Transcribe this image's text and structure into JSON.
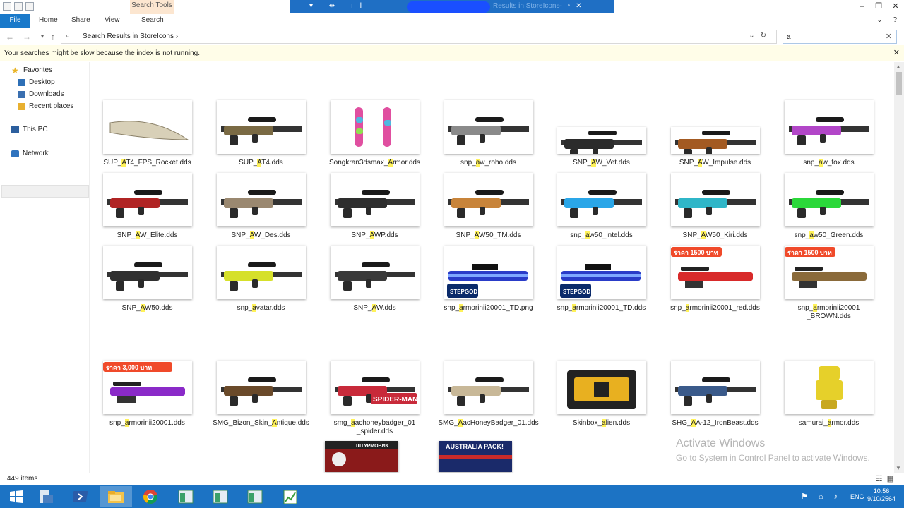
{
  "window": {
    "qat_icons": [
      "folder-icon",
      "properties-icon",
      "new-folder-icon"
    ],
    "contextual_tab": "Search Tools",
    "title_text": "Results in StoreIcons",
    "controls": [
      "minimize",
      "maximize",
      "close"
    ]
  },
  "ribbon": {
    "tabs": [
      "File",
      "Home",
      "Share",
      "View",
      "Search"
    ]
  },
  "address": {
    "path": "Search Results in StoreIcons",
    "search_value": "a"
  },
  "infobar": {
    "message": "Your searches might be slow because the index is not running."
  },
  "nav": {
    "favorites": "Favorites",
    "desktop": "Desktop",
    "downloads": "Downloads",
    "recent": "Recent places",
    "this_pc": "This PC",
    "network": "Network"
  },
  "items": [
    {
      "pre": "SUP_",
      "hl": "A",
      "post": "T4_FPS_Rocket.dds",
      "color": "#d8d0b8"
    },
    {
      "pre": "SUP_",
      "hl": "A",
      "post": "T4.dds",
      "color": "#7a6a44"
    },
    {
      "pre": "Songkran3dsmax_",
      "hl": "A",
      "post": "rmor.dds",
      "color": "#d34f9a"
    },
    {
      "pre": "snp_",
      "hl": "a",
      "post": "w_robo.dds",
      "color": "#8a8a8a"
    },
    {
      "pre": "SNP_",
      "hl": "A",
      "post": "W_Vet.dds",
      "color": "#2b2b2b"
    },
    {
      "pre": "SNP_",
      "hl": "A",
      "post": "W_Impulse.dds",
      "color": "#a35a22"
    },
    {
      "pre": "snp_",
      "hl": "a",
      "post": "w_fox.dds",
      "color": "#b246c8"
    },
    {
      "pre": "SNP_",
      "hl": "A",
      "post": "W_Elite.dds",
      "color": "#b02424"
    },
    {
      "pre": "SNP_",
      "hl": "A",
      "post": "W_Des.dds",
      "color": "#9a8870"
    },
    {
      "pre": "SNP_",
      "hl": "A",
      "post": "WP.dds",
      "color": "#2e2e2e"
    },
    {
      "pre": "SNP_",
      "hl": "A",
      "post": "W50_TM.dds",
      "color": "#c8843a"
    },
    {
      "pre": "snp_",
      "hl": "a",
      "post": "w50_intel.dds",
      "color": "#2aa6e8"
    },
    {
      "pre": "SNP_",
      "hl": "A",
      "post": "W50_Kiri.dds",
      "color": "#2fb6c8"
    },
    {
      "pre": "snp_",
      "hl": "a",
      "post": "w50_Green.dds",
      "color": "#2bd83a"
    },
    {
      "pre": "SNP_",
      "hl": "A",
      "post": "W50.dds",
      "color": "#303030"
    },
    {
      "pre": "snp_",
      "hl": "a",
      "post": "vatar.dds",
      "color": "#d6e02a"
    },
    {
      "pre": "SNP_",
      "hl": "A",
      "post": "W.dds",
      "color": "#3a3a3a"
    },
    {
      "pre": "snp_",
      "hl": "a",
      "post": "rmorinii20001_TD.png",
      "color": "#2a3cc8"
    },
    {
      "pre": "snp_",
      "hl": "a",
      "post": "rmorinii20001_TD.dds",
      "color": "#2a3cc8"
    },
    {
      "pre": "snp_",
      "hl": "a",
      "post": "rmorinii20001_red.dds",
      "color": "#d82a2a"
    },
    {
      "pre": "snp_",
      "hl": "a",
      "post": "rmorinii20001",
      "line2": "_BROWN.dds",
      "color": "#8a6a3a"
    },
    {
      "pre": "snp_",
      "hl": "a",
      "post": "rmorinii20001.dds",
      "color": "#8a2ac8"
    },
    {
      "pre": "SMG_Bizon_Skin_",
      "hl": "A",
      "post": "ntique.dds",
      "color": "#6a4a2a"
    },
    {
      "pre": "smg_",
      "hl": "a",
      "post": "achoneybadger_01",
      "line2": "_spider.dds",
      "color": "#c82a3a"
    },
    {
      "pre": "SMG_",
      "hl": "A",
      "post": "acHoneyBadger_01.dds",
      "color": "#c8b898"
    },
    {
      "pre": "Skinbox_",
      "hl": "a",
      "post": "lien.dds",
      "color": "#e8b020"
    },
    {
      "pre": "SHG_",
      "hl": "A",
      "post": "A-12_IronBeast.dds",
      "color": "#3a5a8a"
    },
    {
      "pre": "samurai_",
      "hl": "a",
      "post": "rmor.dds",
      "color": "#e6d02a"
    },
    {
      "pre": "",
      "hl": "",
      "post": "",
      "color": "#8a1a1a"
    },
    {
      "pre": "",
      "hl": "",
      "post": "",
      "color": "#1a3a8a"
    }
  ],
  "thumb_text": {
    "price1": "ราคา 1500 บาท",
    "price2": "ราคา 3,000 บาท",
    "spiderman": "SPIDER-MAN",
    "shturmovik": "ШТУРМОВИК",
    "australia": "AUSTRALIA PACK!",
    "stepgod": "STEPGOD"
  },
  "watermark": {
    "line1": "Activate Windows",
    "line2": "Go to System in Control Panel to activate Windows."
  },
  "status": {
    "count": "449 items"
  },
  "taskbar": {
    "lang": "ENG",
    "time": "10:56",
    "date": "9/10/2564"
  }
}
